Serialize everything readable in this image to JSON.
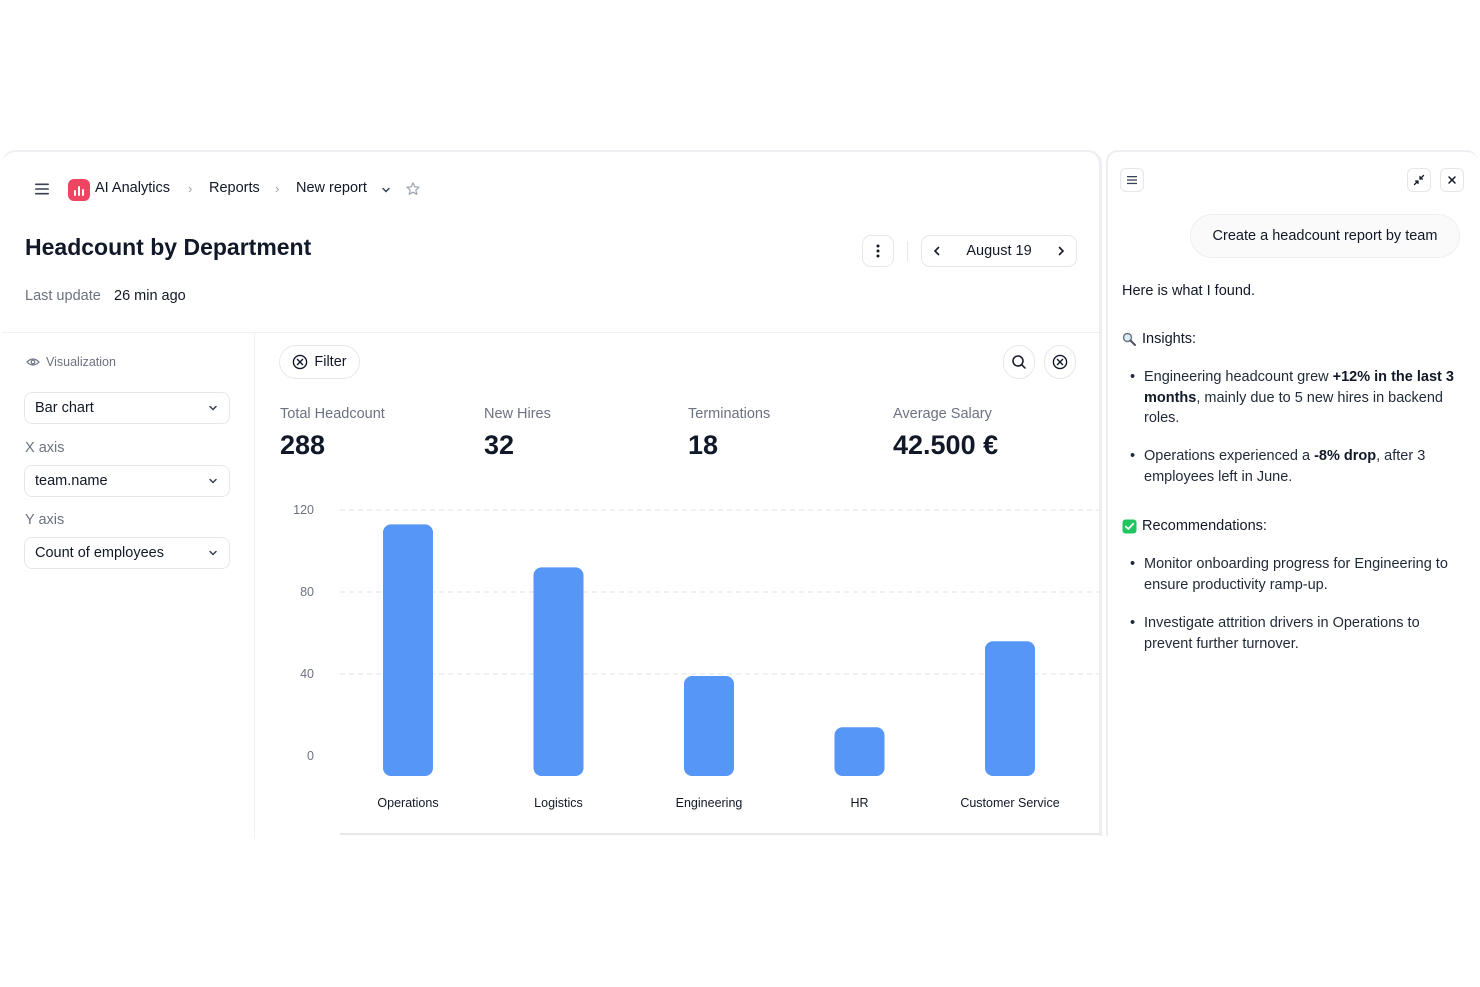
{
  "header": {
    "app_name": "AI Analytics",
    "crumb_reports": "Reports",
    "crumb_current": "New report"
  },
  "report": {
    "title": "Headcount by Department",
    "last_update_label": "Last update",
    "last_update_value": "26 min ago",
    "date": "August 19"
  },
  "config": {
    "visualization_label": "Visualization",
    "chart_type": "Bar chart",
    "x_axis_label": "X axis",
    "x_axis_value": "team.name",
    "y_axis_label": "Y axis",
    "y_axis_value": "Count of employees"
  },
  "toolbar": {
    "filter_label": "Filter"
  },
  "stats": [
    {
      "label": "Total Headcount",
      "value": "288"
    },
    {
      "label": "New Hires",
      "value": "32"
    },
    {
      "label": "Terminations",
      "value": "18"
    },
    {
      "label": "Average Salary",
      "value": "42.500 €"
    }
  ],
  "chart_data": {
    "type": "bar",
    "categories": [
      "Operations",
      "Logistics",
      "Engineering",
      "HR",
      "Customer Service"
    ],
    "values": [
      113,
      92,
      39,
      14,
      56
    ],
    "y_ticks": [
      "0",
      "40",
      "80",
      "120"
    ],
    "ylim": [
      0,
      120
    ],
    "grid": "dashed horizontal",
    "color": "#5596f7"
  },
  "chat": {
    "user_message": "Create a headcount report by team",
    "intro": "Here is what I found.",
    "insights_title": "Insights:",
    "insights": [
      {
        "pre": "Engineering headcount grew ",
        "bold": "+12% in the last 3 months",
        "post": ", mainly due to 5 new hires in backend roles."
      },
      {
        "pre": "Operations experienced a ",
        "bold": "-8% drop",
        "post": ", after 3 employees left in June."
      }
    ],
    "recommendations_title": "Recommendations:",
    "recommendations": [
      "Monitor onboarding progress for Engineering to ensure productivity ramp-up.",
      "Investigate attrition drivers in Operations to prevent further turnover."
    ]
  },
  "colors": {
    "accent": "#ef4462",
    "bar": "#5596f7",
    "check": "#22c55e"
  }
}
